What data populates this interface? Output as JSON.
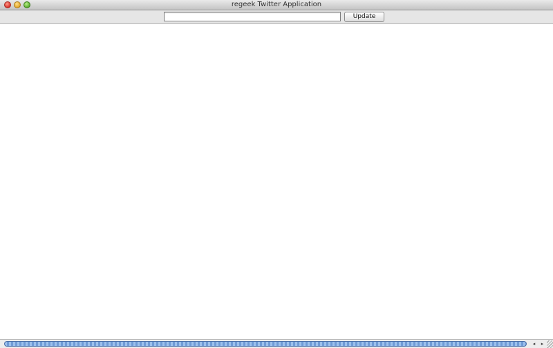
{
  "window": {
    "title": "regeek Twitter Application"
  },
  "composer": {
    "input_value": "",
    "update_label": "Update"
  },
  "timeline": {
    "lines": [
      "",
      "",
      "",
      "",
      "",
      "",
      "",
      "",
      "",
      "",
      "",
      "",
      "",
      "",
      "",
      "",
      "",
      "",
      "",
      "",
      "",
      "",
      "",
      ""
    ]
  },
  "scrollbar": {
    "left_arrow": "◂",
    "right_arrow": "▸"
  },
  "icons": {
    "close": "close-icon",
    "minimize": "minimize-icon",
    "zoom": "zoom-icon",
    "scroll_left": "scroll-left-arrow-icon",
    "scroll_right": "scroll-right-arrow-icon",
    "resize": "resize-grip-icon"
  },
  "colors": {
    "window_background": "#ffffff",
    "toolbar_background": "#e6e6e6",
    "scroll_thumb": "#6f9bd6",
    "traffic_close": "#d8322a",
    "traffic_minimize": "#e3a72a",
    "traffic_zoom": "#5aab2e"
  }
}
